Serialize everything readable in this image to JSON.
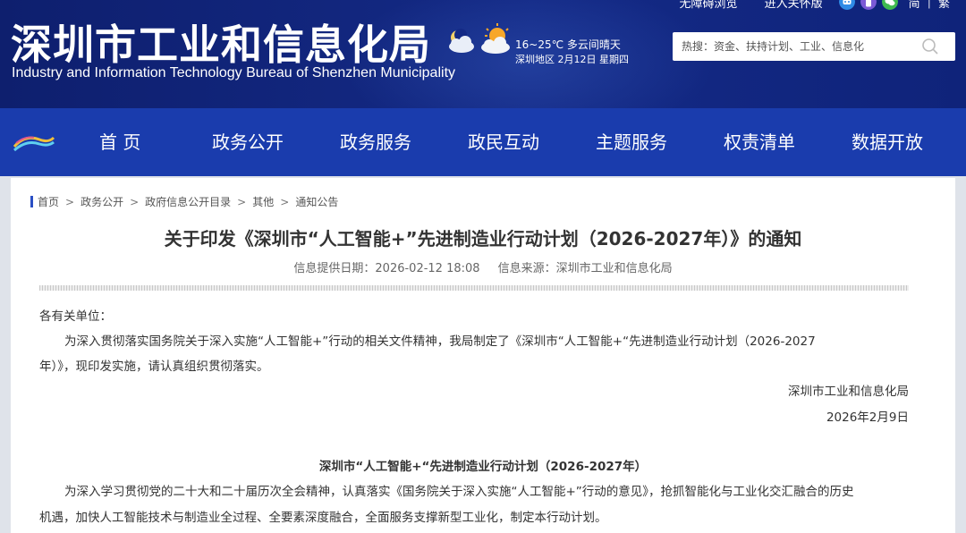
{
  "header": {
    "title": "深圳市工业和信息化局",
    "subtitle": "Industry and Information Technology Bureau of Shenzhen Municipality",
    "weather": {
      "temp_desc": "16~25℃  多云间晴天",
      "location_date": "深圳地区 2月12日  星期四"
    },
    "top_links": {
      "accessible": "无障碍浏览",
      "elderly": "进入关怀版",
      "simplified": "简",
      "traditional": "繁"
    },
    "search": {
      "placeholder": "热搜：资金、扶持计划、工业、信息化"
    }
  },
  "nav": {
    "items": [
      {
        "label": "首 页"
      },
      {
        "label": "政务公开"
      },
      {
        "label": "政务服务"
      },
      {
        "label": "政民互动"
      },
      {
        "label": "主题服务"
      },
      {
        "label": "权责清单"
      },
      {
        "label": "数据开放"
      }
    ]
  },
  "breadcrumb": [
    "首页",
    "政务公开",
    "政府信息公开目录",
    "其他",
    "通知公告"
  ],
  "article": {
    "title": "关于印发《深圳市“人工智能+”先进制造业行动计划（2026-2027年）》的通知",
    "date_label": "信息提供日期：",
    "date_value": "2026-02-12 18:08",
    "source_label": "信息来源：",
    "source_value": "深圳市工业和信息化局",
    "salutation": "各有关单位：",
    "para1_line1": "为深入贯彻落实国务院关于深入实施“人工智能+”行动的相关文件精神，我局制定了《深圳市“人工智能+“先进制造业行动计划（2026-2027",
    "para1_line2": "年）》，现印发实施，请认真组织贯彻落实。",
    "signature": "深圳市工业和信息化局",
    "sign_date": "2026年2月9日",
    "plan_title": "深圳市“人工智能+“先进制造业行动计划（2026-2027年）",
    "para2_line1": "为深入学习贯彻党的二十大和二十届历次全会精神，认真落实《国务院关于深入实施“人工智能+”行动的意见》，抢抓智能化与工业化交汇融合的历史",
    "para2_line2": "机遇，加快人工智能技术与制造业全过程、全要素深度融合，全面服务支撑新型工业化，制定本行动计划。"
  },
  "colors": {
    "header_bg": "#142a86",
    "nav_bg": "#1a3cad",
    "page_bg": "#dfe3ea",
    "accent": "#2a4fc4"
  },
  "icons": {
    "weather": [
      "cloudy-moon-icon",
      "partly-sunny-icon"
    ],
    "top": [
      "robot-icon",
      "phone-icon",
      "wechat-icon"
    ],
    "search": "search-icon",
    "nav_logo": "site-logo-icon"
  }
}
